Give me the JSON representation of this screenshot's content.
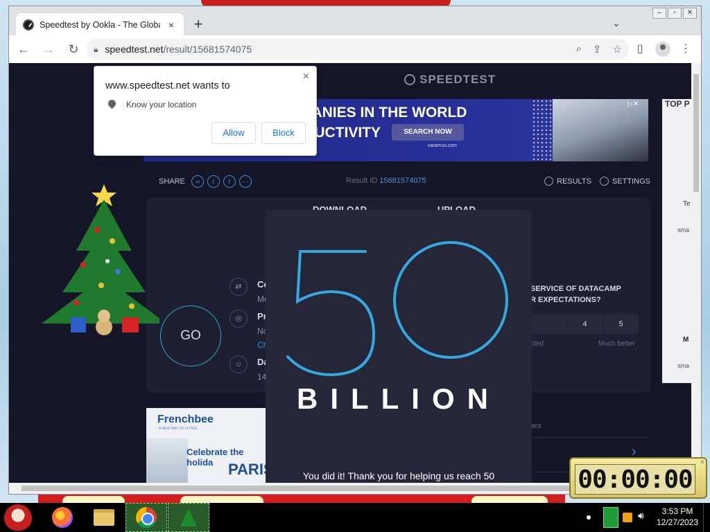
{
  "browser": {
    "tab_title": "Speedtest by Ookla - The Global",
    "tab_close": "×",
    "new_tab": "+",
    "tab_search": "⌄",
    "url_host": "speedtest.net",
    "url_path": "/result/15681574075",
    "window_controls": [
      "‒",
      "▫",
      "✕"
    ]
  },
  "permission_popup": {
    "title": "www.speedtest.net wants to",
    "permission": "Know your location",
    "allow": "Allow",
    "block": "Block",
    "close": "×"
  },
  "page": {
    "brand": "SPEEDTEST",
    "ad_banner": {
      "line1": "PANIES IN THE WORLD",
      "line2": "OUCTIVITY",
      "button": "SEARCH NOW",
      "brand": "varamus.com",
      "close": "▷✕"
    },
    "right_ad": {
      "title": "TOP P",
      "t1": "Te",
      "t2": "sma",
      "t3": "M",
      "t4": "sma"
    },
    "share_label": "SHARE",
    "result_id_label": "Result ID",
    "result_id": "15681574075",
    "results_label": "RESULTS",
    "settings_label": "SETTINGS",
    "go_label": "GO",
    "peek_texts": {
      "download": "DOWNLOAD",
      "upload": "UPLOAD",
      "co": "Co",
      "mu": "Mu",
      "pr": "Pr",
      "no": "No",
      "ch": "Ch",
      "da": "Da",
      "num": "14"
    },
    "survey": {
      "question_line1": "SERVICE OF DATACAMP",
      "question_line2": "R EXPECTATIONS?",
      "ratings": [
        "",
        "4",
        "5"
      ],
      "hint_left": "cted",
      "hint_right": "Much better"
    },
    "lower_banner": {
      "logo": "Frenchbee",
      "tagline": "A NEW WAY OF FLYING",
      "line1": "Celebrate the holida",
      "line2": "PARIS"
    },
    "lower_right_text": "ues",
    "lower_right_arrow": "›"
  },
  "modal": {
    "number": "50",
    "word": "BILLION",
    "thanks": "You did it! Thank you for helping us reach 50"
  },
  "timer": {
    "display": "00:00:00",
    "close": "×"
  },
  "taskbar": {
    "time": "3:53 PM",
    "date": "12/27/2023"
  },
  "colors": {
    "accent_blue": "#3aa3d9",
    "page_bg": "#141526",
    "link_blue": "#1a73e8"
  },
  "icons": [
    "back-icon",
    "forward-icon",
    "reload-icon",
    "lock-icon",
    "zoom-icon",
    "share-icon",
    "bookmark-star-icon",
    "side-panel-icon",
    "profile-icon",
    "menu-icon",
    "location-pin-icon",
    "link-icon",
    "twitter-icon",
    "facebook-icon",
    "more-icon",
    "check-circle-icon",
    "gear-icon"
  ]
}
